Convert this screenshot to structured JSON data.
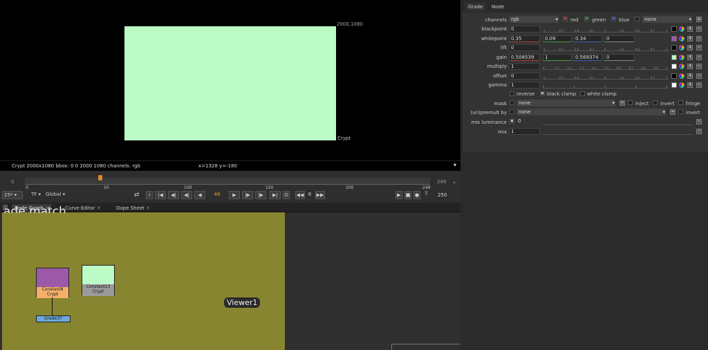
{
  "viewer": {
    "resolution_label": "2000,1080",
    "node_label": "Crypt",
    "info_text": "Crypt 2000x1080  bbox: 0 0 2000 1080 channels: rgb",
    "coords_text": "x=1328 y=-180",
    "image_color": "#bdfbc6"
  },
  "timeline": {
    "start_frame": "0",
    "end_frame": "249",
    "ticks": [
      "0",
      "50",
      "100",
      "150",
      "200",
      "249"
    ],
    "current_frame": "46",
    "fps": "25*",
    "tf": "TF",
    "scope": "Global",
    "step": "8",
    "out_frame": "250",
    "marker": "46"
  },
  "tabs": [
    "Node Graph",
    "Curve Editor",
    "Dope Sheet"
  ],
  "nodegraph": {
    "backdrop_title": "ade match",
    "backdrop_color": "#888530",
    "nodes": [
      {
        "label": "Constant8",
        "sub": "Crypt",
        "color": "#9b59a8"
      },
      {
        "label": "Constant13",
        "sub": "Crypt",
        "color": "#bdfbc6"
      },
      {
        "label": "Grade37",
        "sub": "",
        "color": "#6fa8dc"
      }
    ],
    "viewer_label": "Viewer1"
  },
  "properties": {
    "tabs": [
      "Grade",
      "Node"
    ],
    "channels": {
      "label": "channels",
      "value": "rgb",
      "red": "red",
      "green": "green",
      "blue": "blue",
      "alpha": "none"
    },
    "rows": [
      {
        "label": "blackpoint",
        "value": "0",
        "swatch": "#000000"
      },
      {
        "label": "whitepoint",
        "value": "0.35",
        "g": "0.09",
        "b": "0.34",
        "a": "0",
        "swatch": "#9b59a8"
      },
      {
        "label": "lift",
        "value": "0",
        "swatch": "#000000"
      },
      {
        "label": "gain",
        "value": "0.508539",
        "g": "1",
        "b": "0.569374",
        "a": "0",
        "swatch": "#bdfbc6"
      },
      {
        "label": "multiply",
        "value": "1",
        "swatch": "#ffffff"
      },
      {
        "label": "offset",
        "value": "0",
        "swatch": "#000000"
      },
      {
        "label": "gamma",
        "value": "1",
        "swatch": "#ffffff"
      }
    ],
    "channel_count": "4",
    "reverse": "reverse",
    "black_clamp": "black clamp",
    "white_clamp": "white clamp",
    "mask_label": "mask",
    "mask_value": "none",
    "inject": "inject",
    "invert": "invert",
    "fringe": "fringe",
    "unpremult_label": "(un)premult by",
    "unpremult_value": "none",
    "invert2": "invert",
    "mix_luminance_label": "mix luminance",
    "mix_luminance_value": "0",
    "mix_label": "mix",
    "mix_value": "1",
    "ticks_a": [
      "-1",
      "-0.7",
      "-0.4",
      "-0.1",
      "0",
      "0.2",
      "0.4",
      "0.7",
      "1"
    ],
    "ticks_b": [
      "0",
      "0.1",
      "0.2",
      "0.3",
      "0.4",
      "0.5",
      "0.6",
      "0.7",
      "0.8",
      "0.9",
      "1"
    ],
    "ticks_c": [
      "0",
      "1",
      "2",
      "3",
      "4"
    ]
  }
}
